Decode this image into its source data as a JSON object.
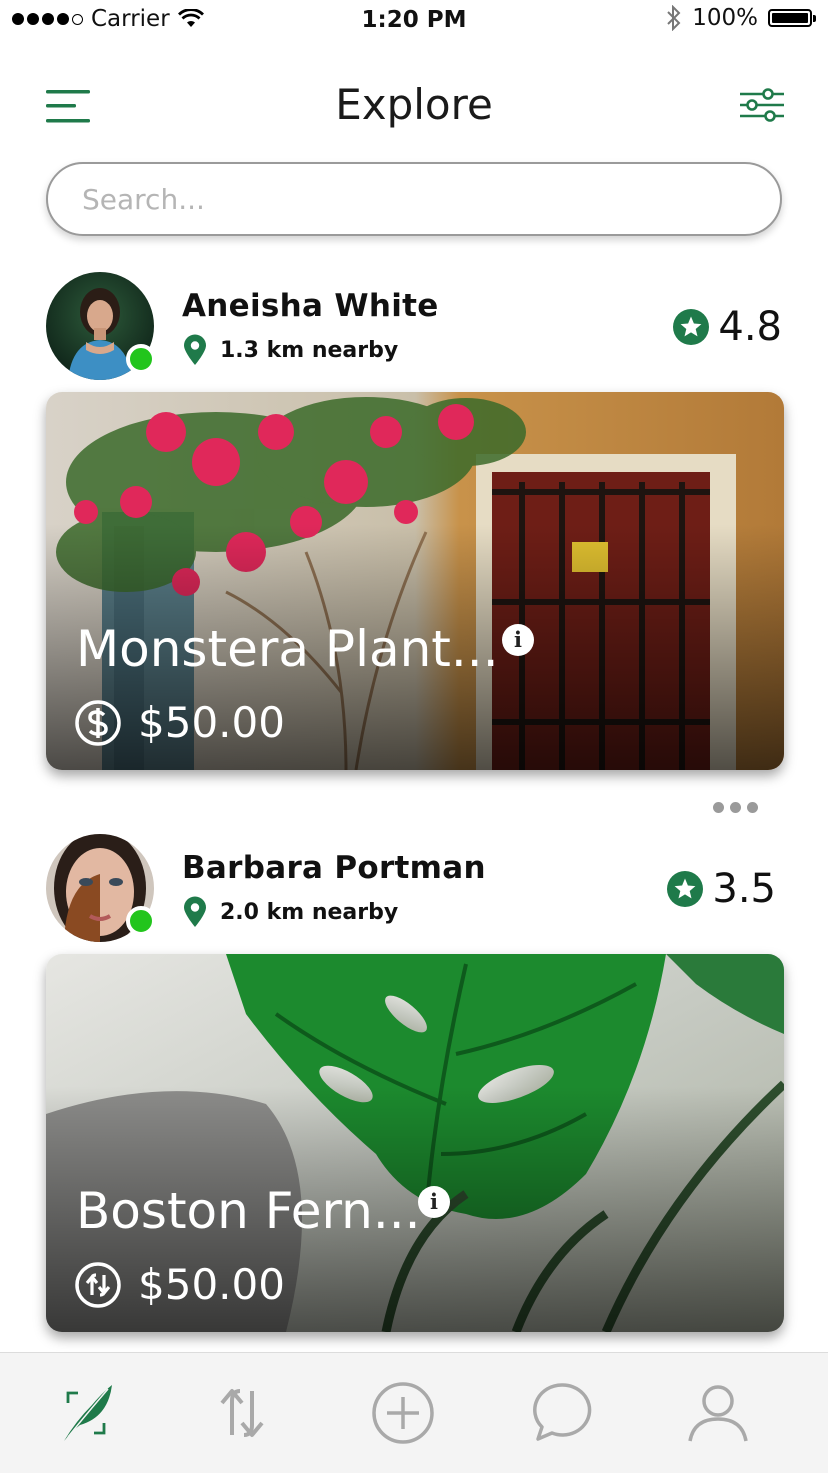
{
  "status_bar": {
    "carrier": "Carrier",
    "time": "1:20 PM",
    "battery": "100%"
  },
  "header": {
    "title": "Explore",
    "menu_icon": "hamburger-menu-icon",
    "filter_icon": "filter-sliders-icon"
  },
  "search": {
    "placeholder": "Search..."
  },
  "listings": [
    {
      "seller": "Aneisha White",
      "distance": "1.3 km nearby",
      "rating": "4.8",
      "online": true,
      "title": "Monstera Plant...",
      "price": "$50.00",
      "price_icon": "dollar-circle-icon"
    },
    {
      "seller": "Barbara Portman",
      "distance": "2.0 km nearby",
      "rating": "3.5",
      "online": true,
      "title": "Boston Fern...",
      "price": "$50.00",
      "price_icon": "swap-circle-icon"
    }
  ],
  "tabbar": {
    "items": [
      "leaf-icon",
      "swap-icon",
      "add-icon",
      "chat-icon",
      "profile-icon"
    ],
    "active": "leaf-icon"
  },
  "colors": {
    "accent": "#1f7a4a",
    "online": "#22c51c",
    "inactive_tab": "#a9a9a9"
  }
}
